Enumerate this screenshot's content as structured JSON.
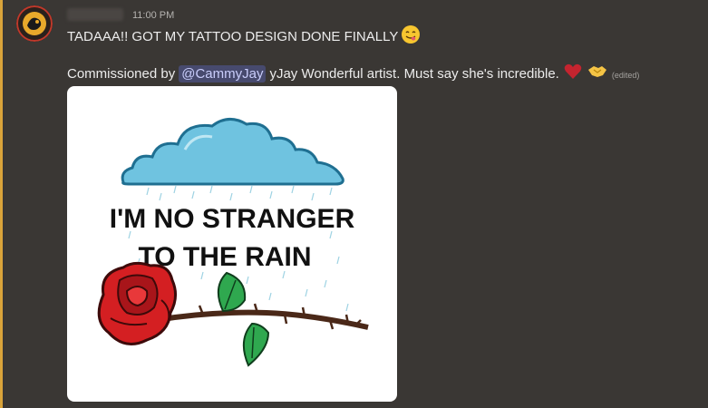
{
  "message": {
    "timestamp": "11:00 PM",
    "line1_text": "TADAAA!! GOT MY TATTOO DESIGN DONE FINALLY",
    "line2_prefix": "Commissioned by",
    "mention": "@CammyJay",
    "line2_rest": "yJay Wonderful artist. Must say she's incredible.",
    "edited_label": "(edited)"
  },
  "attachment": {
    "text_line1": "I'M NO STRANGER",
    "text_line2": "TO THE RAIN"
  },
  "colors": {
    "accent_bar": "#d9a33a",
    "mention_bg": "#474a6e",
    "mention_text": "#c9cdfb",
    "background": "#3a3734"
  },
  "icons": {
    "reaction_1": "yum-face-icon",
    "reaction_2": "red-heart-icon",
    "reaction_3": "handshake-icon"
  }
}
